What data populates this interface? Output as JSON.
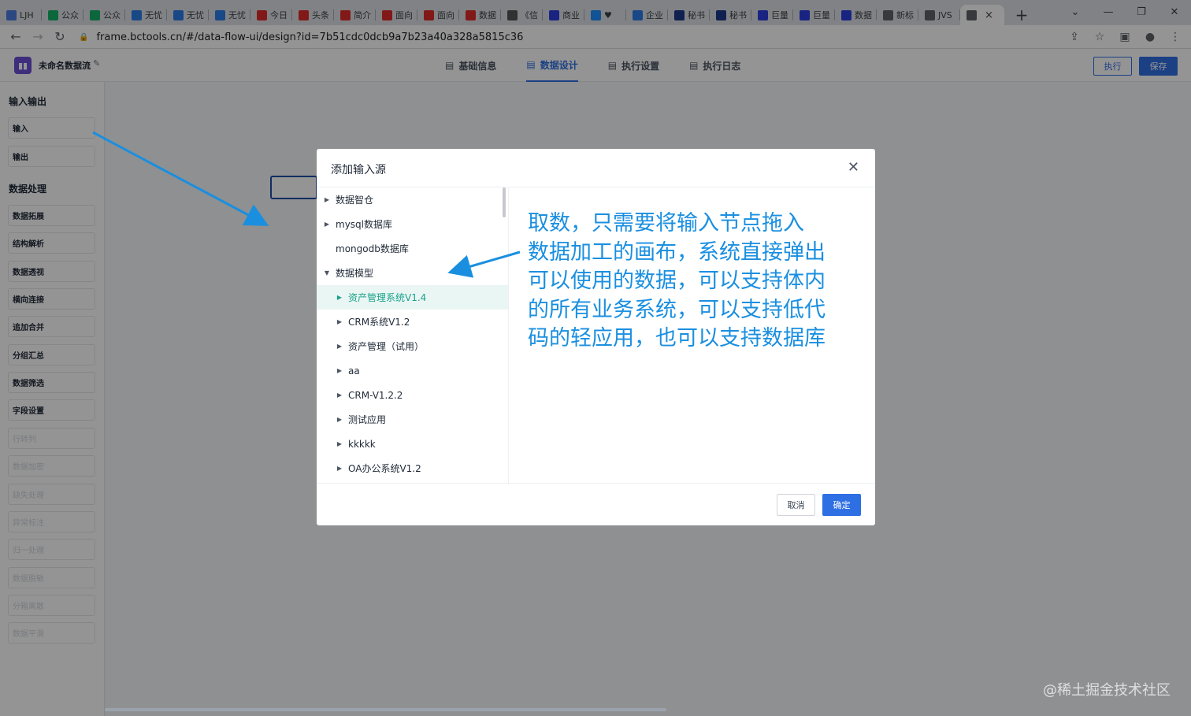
{
  "browser": {
    "tabs": [
      {
        "label": "LJH",
        "color": "#4a7de0"
      },
      {
        "label": "公众",
        "color": "#17b26a"
      },
      {
        "label": "公众",
        "color": "#17b26a"
      },
      {
        "label": "无忧",
        "color": "#2b7de9"
      },
      {
        "label": "无忧",
        "color": "#2b7de9"
      },
      {
        "label": "无忧",
        "color": "#2b7de9"
      },
      {
        "label": "今日",
        "color": "#e02b2b"
      },
      {
        "label": "头条",
        "color": "#e02b2b"
      },
      {
        "label": "简介",
        "color": "#e02b2b"
      },
      {
        "label": "面向",
        "color": "#e02b2b"
      },
      {
        "label": "面向",
        "color": "#e02b2b"
      },
      {
        "label": "数据",
        "color": "#e02b2b"
      },
      {
        "label": "《信",
        "color": "#555555"
      },
      {
        "label": "商业",
        "color": "#2b3fe0"
      },
      {
        "label": "♥",
        "color": "#1e90ff"
      },
      {
        "label": "企业",
        "color": "#2b7de9"
      },
      {
        "label": "秘书",
        "color": "#1d3a8a"
      },
      {
        "label": "秘书",
        "color": "#1d3a8a"
      },
      {
        "label": "巨量",
        "color": "#2b3fe0"
      },
      {
        "label": "巨量",
        "color": "#2b3fe0"
      },
      {
        "label": "数据",
        "color": "#2b3fe0"
      },
      {
        "label": "新标",
        "color": "#5f6368"
      },
      {
        "label": "JVS",
        "color": "#5f6368"
      }
    ],
    "active_tab_close": "×",
    "new_tab": "+",
    "window_controls": [
      "⌄",
      "—",
      "❐",
      "✕"
    ],
    "url": "frame.bctools.cn/#/data-flow-ui/design?id=7b51cdc0dcb9a7b23a40a328a5815c36"
  },
  "app": {
    "flow_name": "未命名数据流",
    "tabs": [
      {
        "label": "基础信息",
        "active": false
      },
      {
        "label": "数据设计",
        "active": true
      },
      {
        "label": "执行设置",
        "active": false
      },
      {
        "label": "执行日志",
        "active": false
      }
    ],
    "run_label": "执行",
    "save_label": "保存"
  },
  "sidebar": {
    "io_title": "输入输出",
    "io_nodes": [
      "输入",
      "输出"
    ],
    "proc_title": "数据处理",
    "proc_nodes": [
      "数据拓展",
      "结构解析",
      "数据透视",
      "横向连接",
      "追加合并",
      "分组汇总",
      "数据筛选",
      "字段设置"
    ],
    "dim_nodes": [
      "行转列",
      "数据加密",
      "缺失处理",
      "异常标注",
      "归一处理",
      "数据脱敏",
      "分箱离散",
      "数据平滑"
    ]
  },
  "modal": {
    "title": "添加输入源",
    "tree": [
      {
        "label": "数据智仓",
        "level": 0,
        "arrow": "▶"
      },
      {
        "label": "mysql数据库",
        "level": 0,
        "arrow": "▶"
      },
      {
        "label": "mongodb数据库",
        "level": 0,
        "arrow": ""
      },
      {
        "label": "数据模型",
        "level": 0,
        "arrow": "▼"
      },
      {
        "label": "资产管理系统V1.4",
        "level": 1,
        "arrow": "▶",
        "selected": true
      },
      {
        "label": "CRM系统V1.2",
        "level": 1,
        "arrow": "▶"
      },
      {
        "label": "资产管理（试用）",
        "level": 1,
        "arrow": "▶"
      },
      {
        "label": "aa",
        "level": 1,
        "arrow": "▶"
      },
      {
        "label": "CRM-V1.2.2",
        "level": 1,
        "arrow": "▶"
      },
      {
        "label": "测试应用",
        "level": 1,
        "arrow": "▶"
      },
      {
        "label": "kkkkk",
        "level": 1,
        "arrow": "▶"
      },
      {
        "label": "OA办公系统V1.2",
        "level": 1,
        "arrow": "▶"
      }
    ],
    "cancel_label": "取消",
    "ok_label": "确定"
  },
  "annotation": {
    "lines": [
      "取数，只需要将输入节点拖入",
      "数据加工的画布，系统直接弹出",
      "可以使用的数据，可以支持体内",
      "的所有业务系统，可以支持低代",
      "码的轻应用，也可以支持数据库"
    ],
    "color": "#1a8fe0"
  },
  "watermark": "@稀土掘金技术社区"
}
